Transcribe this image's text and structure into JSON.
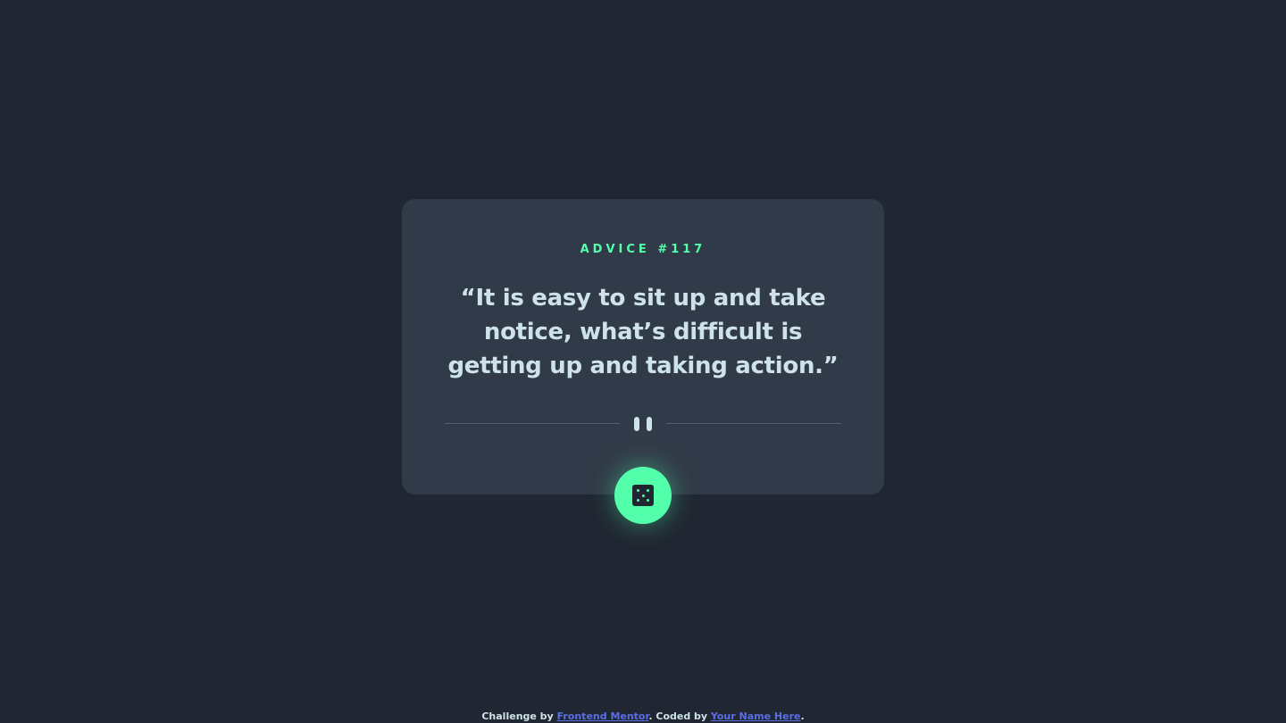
{
  "card": {
    "advice_label": "ADVICE #117",
    "quote": "“It is easy to sit up and take notice, what’s difficult is getting up and taking action.”"
  },
  "icons": {
    "divider": "pause-icon",
    "button": "dice-icon"
  },
  "footer": {
    "challenge_prefix": "Challenge by ",
    "challenge_link": "Frontend Mentor",
    "coded_prefix": ". Coded by ",
    "coded_link": "Your Name Here",
    "suffix": "."
  },
  "colors": {
    "background": "#202632",
    "card": "#313a48",
    "accent": "#53ffaa",
    "text": "#cee3e9",
    "link": "#5a6ee8"
  }
}
